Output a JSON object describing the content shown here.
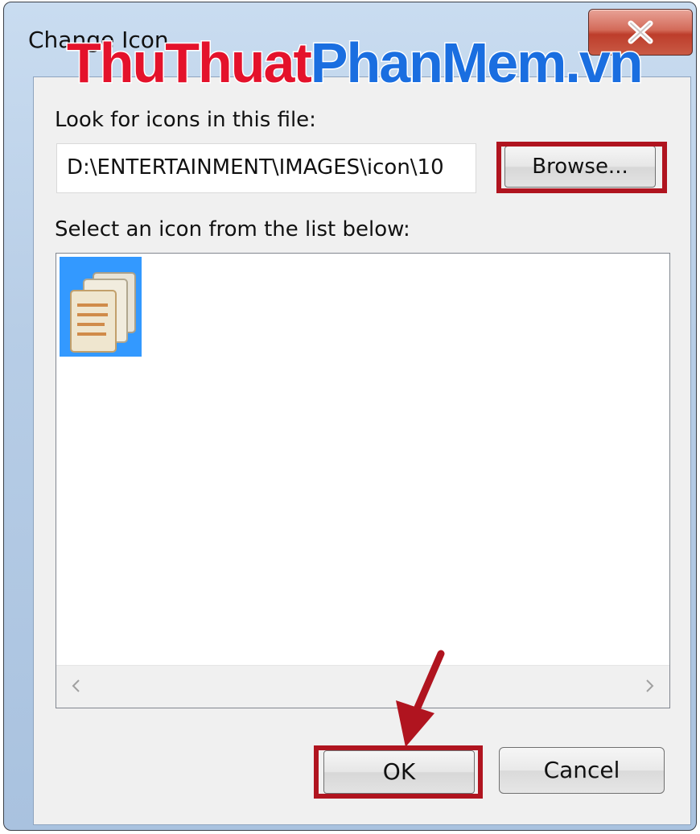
{
  "window": {
    "title": "Change Icon",
    "close_symbol": "✕"
  },
  "watermark": {
    "part1": "ThuThuat",
    "part2": "PhanMem.vn"
  },
  "dialog": {
    "look_for_label": "Look for icons in this file:",
    "file_path_value": "D:\\ENTERTAINMENT\\IMAGES\\icon\\10",
    "browse_label": "Browse...",
    "select_label": "Select an icon from the list below:",
    "icons": [
      {
        "icon": "documents-stack-icon",
        "selected": true
      }
    ],
    "ok_label": "OK",
    "cancel_label": "Cancel"
  },
  "annotations": {
    "highlight_color": "#b0141f",
    "arrow_color": "#b0141f"
  }
}
